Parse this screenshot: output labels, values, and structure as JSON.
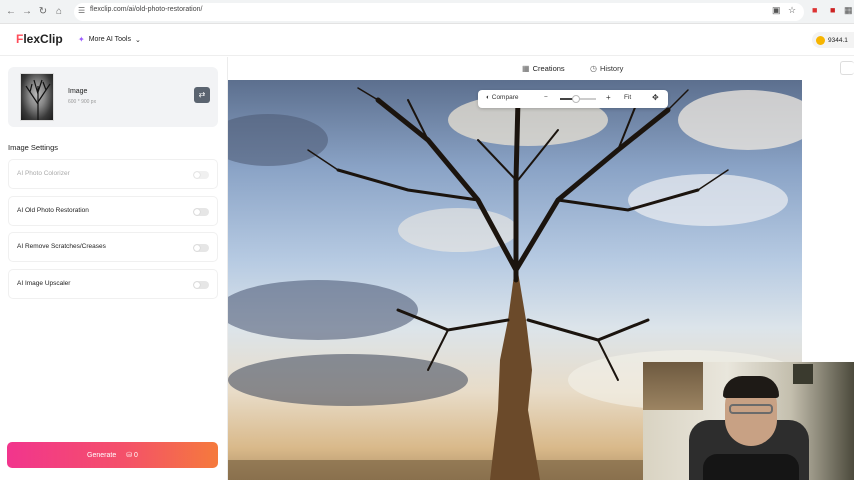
{
  "browser": {
    "url": "flexclip.com/ai/old-photo-restoration/"
  },
  "header": {
    "logo_text_accent": "F",
    "logo_text_rest": "lexClip",
    "more_tools_label": "More AI Tools",
    "credits": "9344.1"
  },
  "left_panel": {
    "image_card": {
      "title": "Image",
      "size": "600 * 900 px"
    },
    "section_title": "Image Settings",
    "settings": [
      {
        "label": "AI Photo Colorizer",
        "enabled": false,
        "disabled": true
      },
      {
        "label": "AI Old Photo Restoration",
        "enabled": false,
        "disabled": false
      },
      {
        "label": "AI Remove Scratches/Creases",
        "enabled": false,
        "disabled": false
      },
      {
        "label": "AI Image Upscaler",
        "enabled": false,
        "disabled": false
      }
    ],
    "generate": {
      "label": "Generate",
      "cost": "0"
    }
  },
  "main": {
    "tabs": [
      {
        "label": "Creations",
        "active": true
      },
      {
        "label": "History",
        "active": false
      }
    ],
    "zoombar": {
      "compare_label": "Compare",
      "fit_label": "Fit",
      "minus": "−",
      "plus": "+"
    }
  },
  "colors": {
    "accent_pink": "#f2358d",
    "accent_orange": "#f57a3c",
    "logo_red": "#ff4d5a",
    "coin": "#f7b500"
  }
}
